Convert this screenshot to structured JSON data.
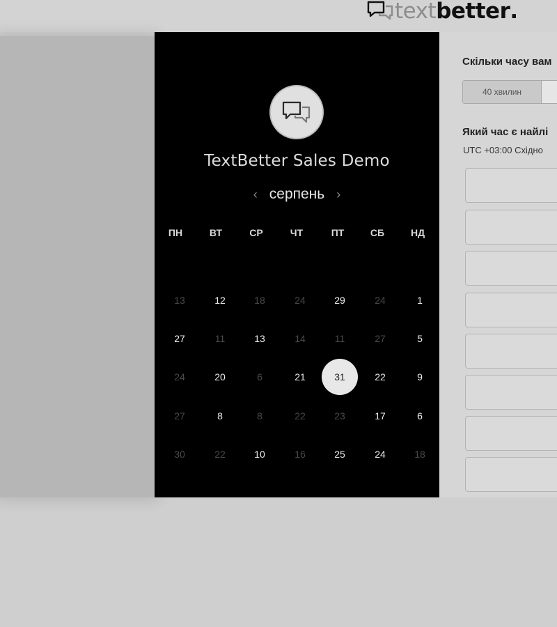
{
  "header": {
    "logo_light": "text",
    "logo_bold": "better",
    "logo_mark": ".",
    "logo_icon": "chat-bubbles-icon"
  },
  "calendar": {
    "title": "TextBetter Sales Demo",
    "avatar_icon": "chat-bubbles-icon",
    "month": "серпень",
    "prev_icon": "chevron-left-icon",
    "next_icon": "chevron-right-icon",
    "weekdays": [
      "ПН",
      "ВТ",
      "СР",
      "ЧТ",
      "ПТ",
      "СБ",
      "НД"
    ],
    "weeks": [
      [
        {
          "d": "13",
          "a": false
        },
        {
          "d": "12",
          "a": true
        },
        {
          "d": "18",
          "a": false
        },
        {
          "d": "24",
          "a": false
        },
        {
          "d": "29",
          "a": true
        },
        {
          "d": "24",
          "a": false
        },
        {
          "d": "1",
          "a": true
        }
      ],
      [
        {
          "d": "27",
          "a": true
        },
        {
          "d": "11",
          "a": false
        },
        {
          "d": "13",
          "a": true
        },
        {
          "d": "14",
          "a": false
        },
        {
          "d": "11",
          "a": false
        },
        {
          "d": "27",
          "a": false
        },
        {
          "d": "5",
          "a": true
        }
      ],
      [
        {
          "d": "24",
          "a": false
        },
        {
          "d": "20",
          "a": true
        },
        {
          "d": "6",
          "a": false
        },
        {
          "d": "21",
          "a": true
        },
        {
          "d": "31",
          "a": true,
          "selected": true
        },
        {
          "d": "22",
          "a": true
        },
        {
          "d": "9",
          "a": true
        }
      ],
      [
        {
          "d": "27",
          "a": false
        },
        {
          "d": "8",
          "a": true
        },
        {
          "d": "8",
          "a": false
        },
        {
          "d": "22",
          "a": false
        },
        {
          "d": "23",
          "a": false
        },
        {
          "d": "17",
          "a": true
        },
        {
          "d": "6",
          "a": true
        }
      ],
      [
        {
          "d": "30",
          "a": false
        },
        {
          "d": "22",
          "a": false
        },
        {
          "d": "10",
          "a": true
        },
        {
          "d": "16",
          "a": false
        },
        {
          "d": "25",
          "a": true
        },
        {
          "d": "24",
          "a": true
        },
        {
          "d": "18",
          "a": false
        }
      ]
    ]
  },
  "booking": {
    "duration_question": "Скільки часу вам",
    "duration_option": "40 хвилин",
    "time_question": "Який час є найлі",
    "timezone": "UTC +03:00 Східно"
  },
  "colors": {
    "panel_dark": "#000000",
    "selected_day": "#e8e8e8",
    "right_panel": "#d6d6d6"
  }
}
